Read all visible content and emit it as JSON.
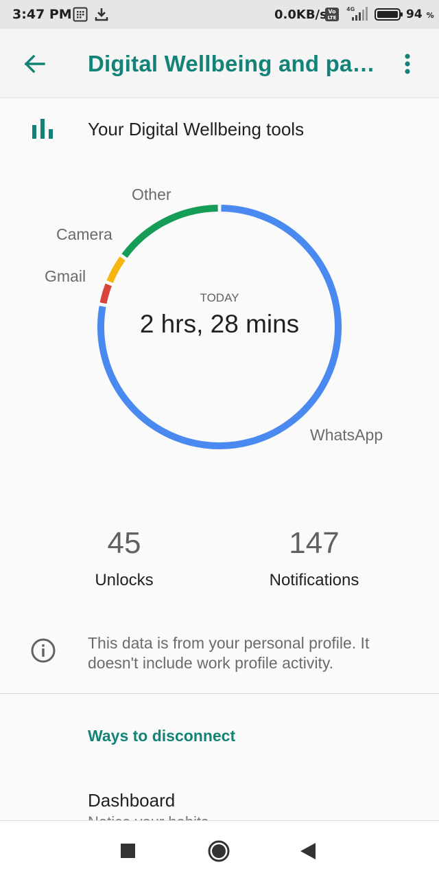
{
  "status_bar": {
    "time": "3:47 PM",
    "net_speed": "0.0KB/s",
    "battery_percent": "94",
    "battery_unit": "%",
    "icons": [
      "sim-grid-icon",
      "download-icon",
      "volte-icon",
      "signal-icon",
      "battery-icon"
    ]
  },
  "app_bar": {
    "title": "Digital Wellbeing and pa…",
    "back_icon": "arrow-back-icon",
    "menu_icon": "more-vert-icon"
  },
  "tools": {
    "label": "Your Digital Wellbeing tools",
    "icon": "bar-chart-icon"
  },
  "usage": {
    "period": "TODAY",
    "total": "2 hrs, 28 mins",
    "apps": [
      {
        "name": "WhatsApp",
        "color": "#4a89f0"
      },
      {
        "name": "Gmail",
        "color": "#d8433a"
      },
      {
        "name": "Camera",
        "color": "#f6b60f"
      },
      {
        "name": "Other",
        "color": "#159c57"
      }
    ]
  },
  "chart_data": {
    "type": "pie",
    "categories": [
      "WhatsApp",
      "Gmail",
      "Camera",
      "Other"
    ],
    "values": [
      78,
      3,
      4,
      15
    ],
    "colors": [
      "#4a89f0",
      "#d8433a",
      "#f6b60f",
      "#159c57"
    ]
  },
  "stats": {
    "unlocks_value": "45",
    "unlocks_label": "Unlocks",
    "notifications_value": "147",
    "notifications_label": "Notifications"
  },
  "info": {
    "icon": "info-icon",
    "text": "This data is from your personal profile. It doesn't include work profile activity."
  },
  "section": {
    "title": "Ways to disconnect"
  },
  "dashboard": {
    "title": "Dashboard",
    "subtitle": "Notice your habits"
  },
  "nav_bar": {
    "icons": [
      "recents-square-icon",
      "home-circle-icon",
      "back-triangle-icon"
    ]
  }
}
